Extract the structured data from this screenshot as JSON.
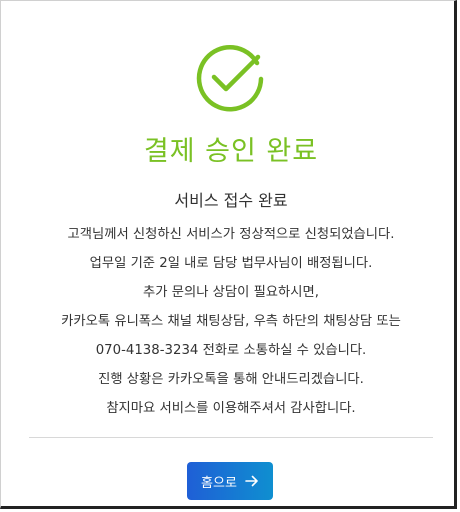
{
  "colors": {
    "accent_green": "#7ac124",
    "button_blue_start": "#1f5fd6",
    "button_blue_end": "#0f8fd0",
    "text": "#333333",
    "divider": "#d8d8d8"
  },
  "icons": {
    "status": "check-circle-icon",
    "button": "arrow-right-icon"
  },
  "status": {
    "title": "결제 승인 완료",
    "subtitle": "서비스 접수 완료"
  },
  "message": {
    "lines": [
      "고객님께서 신청하신 서비스가 정상적으로 신청되었습니다.",
      "업무일 기준 2일 내로 담당 법무사님이 배정됩니다.",
      "추가 문의나 상담이 필요하시면,",
      "카카오톡 유니폭스 채널 채팅상담, 우측 하단의 채팅상담 또는",
      "070-4138-3234 전화로 소통하실 수 있습니다.",
      "진행 상황은 카카오톡을 통해 안내드리겠습니다.",
      "참지마요 서비스를 이용해주셔서 감사합니다."
    ]
  },
  "actions": {
    "home_label": "홈으로"
  }
}
